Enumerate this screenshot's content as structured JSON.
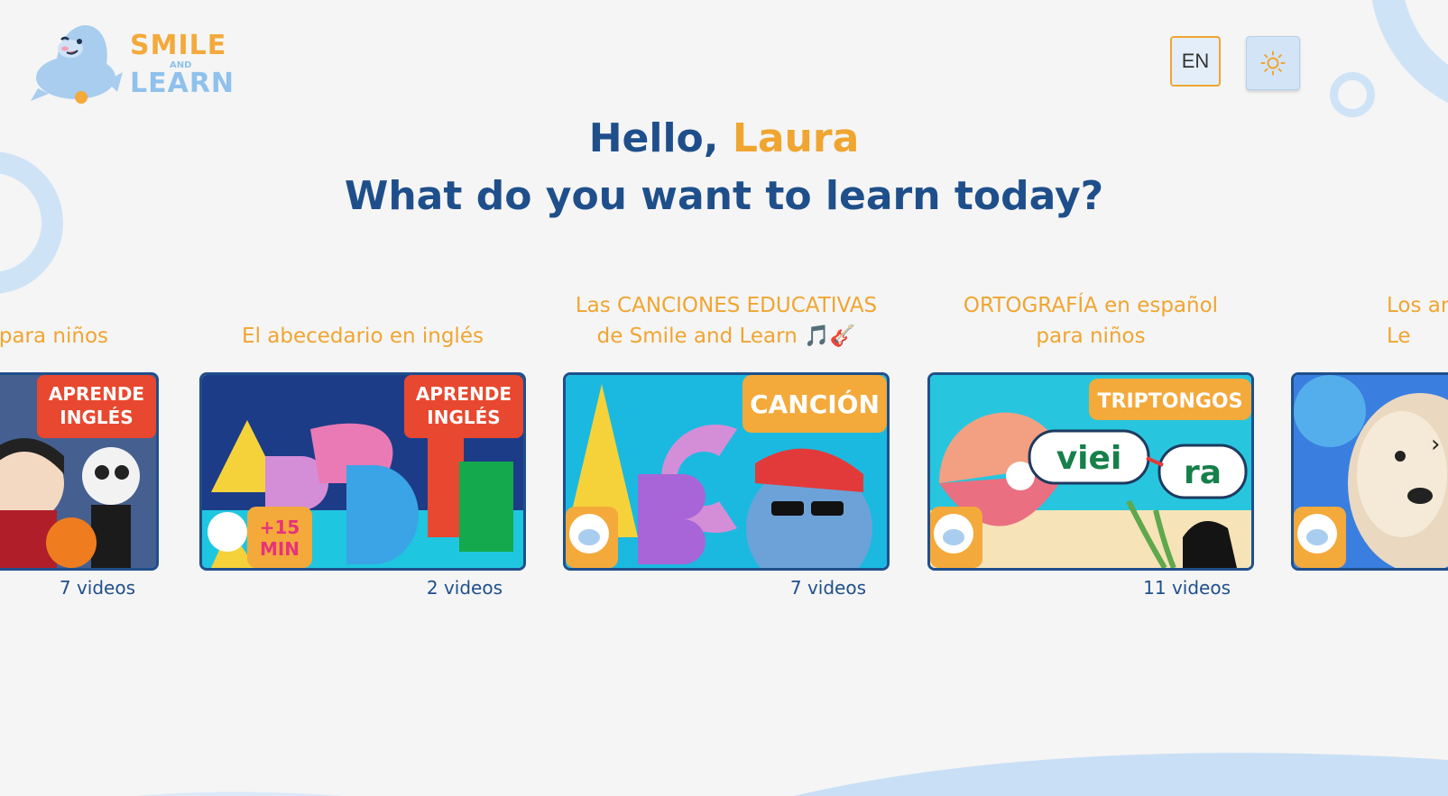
{
  "header": {
    "logo": {
      "line1": "SMILE",
      "line2": "AND",
      "line3": "LEARN"
    },
    "language_button": "EN",
    "theme_icon": "sun-icon"
  },
  "greeting": {
    "hello": "Hello, ",
    "name": "Laura",
    "question": "What do you want to learn today?"
  },
  "playlists": [
    {
      "title": "para niños",
      "thumb_badge": "APRENDE INGLÉS",
      "count": "7 videos"
    },
    {
      "title": "El abecedario en inglés",
      "thumb_badge": "APRENDE INGLÉS",
      "thumb_sticker": "+15 MIN",
      "count": "2 videos"
    },
    {
      "title": "Las CANCIONES EDUCATIVAS de Smile and Learn 🎵🎸",
      "thumb_badge": "CANCIÓN",
      "count": "7 videos"
    },
    {
      "title": "ORTOGRAFÍA en español para niños",
      "thumb_badge": "TRIPTONGOS",
      "thumb_word_a": "viei",
      "thumb_word_b": "ra",
      "count": "11 videos"
    },
    {
      "title": "Los animales Le",
      "count": ""
    }
  ],
  "carousel": {
    "next_icon": "chevron-right-icon"
  },
  "colors": {
    "navy": "#1f4f8b",
    "orange": "#f0a531",
    "light_blue": "#cfe3f7",
    "background": "#f5f5f5"
  }
}
